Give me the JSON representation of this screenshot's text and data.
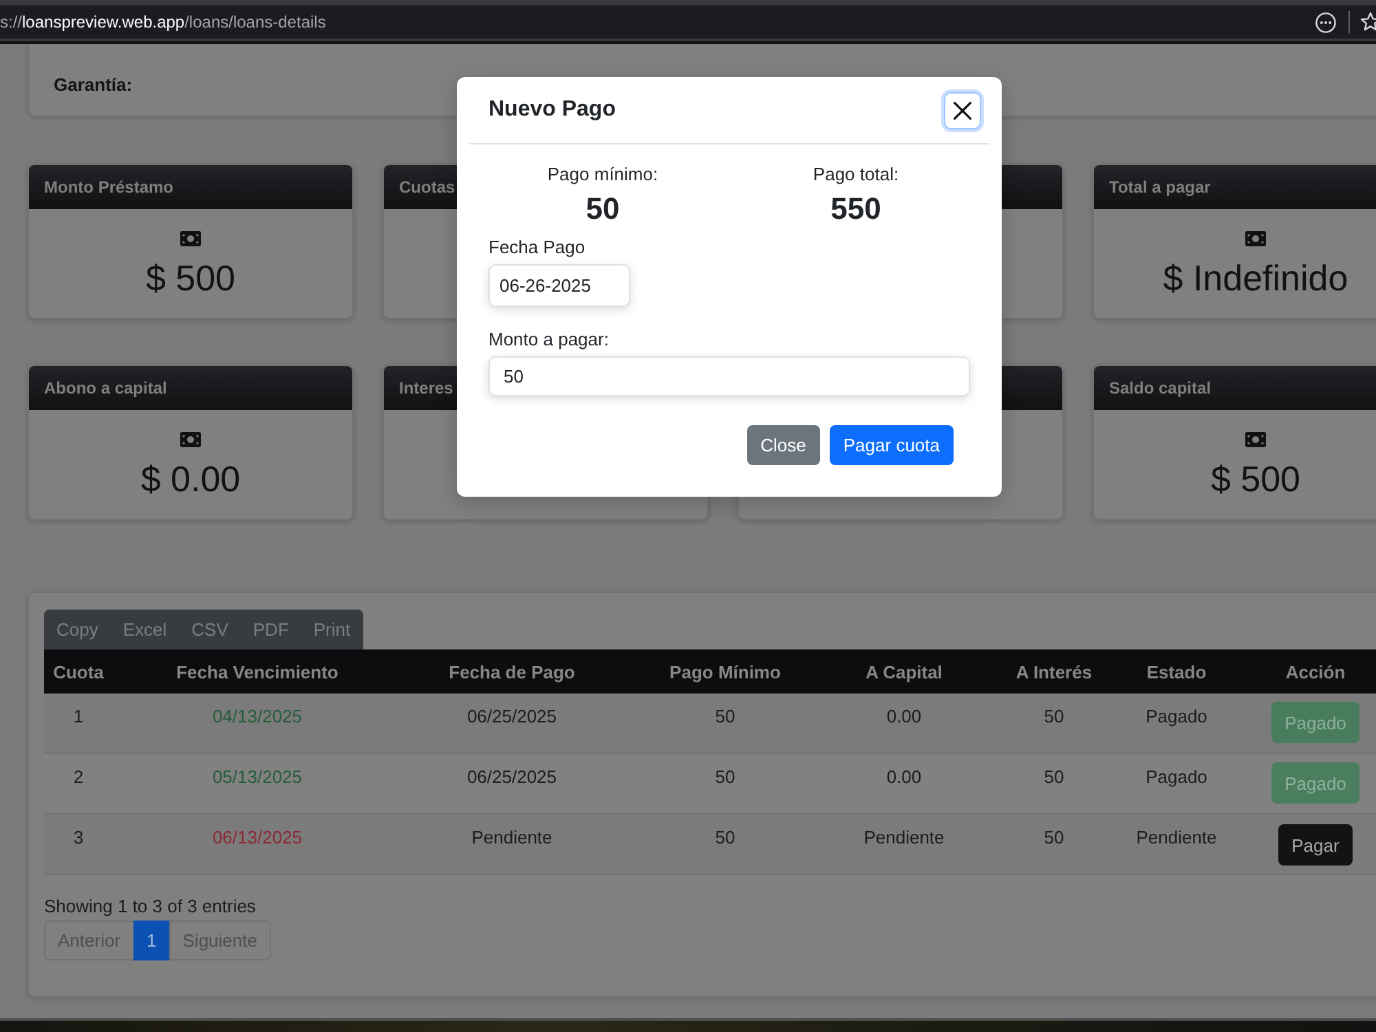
{
  "browser": {
    "address_bar": {
      "scheme": "s://",
      "host": "loanspreview.web.app",
      "path": "/loans/loans-details"
    }
  },
  "guarantee_card": {
    "label": "Garantía:"
  },
  "stat_cards": [
    {
      "title": "Monto Préstamo",
      "icon": true,
      "value": "$ 500"
    },
    {
      "title": "Cuotas",
      "icon": false
    },
    {
      "icon": false
    },
    {
      "title": "Total a pagar",
      "icon": true,
      "value": "$ Indefinido"
    },
    {
      "title": "Abono a capital",
      "icon": true,
      "value": "$ 0.00"
    },
    {
      "title": "Interes",
      "icon": false
    },
    {
      "icon": false
    },
    {
      "title": "Saldo capital",
      "icon": true,
      "value": "$ 500"
    }
  ],
  "payments": {
    "export_buttons": [
      "Copy",
      "Excel",
      "CSV",
      "PDF",
      "Print"
    ],
    "columns": [
      "Cuota",
      "Fecha Vencimiento",
      "Fecha de Pago",
      "Pago Mínimo",
      "A Capital",
      "A Interés",
      "Estado",
      "Acción"
    ],
    "rows": [
      {
        "cells": [
          "1",
          "04/13/2025",
          "06/25/2025",
          "50",
          "0.00",
          "50",
          "Pagado"
        ],
        "overdue": false,
        "action": {
          "label": "Pagado",
          "kind": "paid",
          "disabled": true
        }
      },
      {
        "cells": [
          "2",
          "05/13/2025",
          "06/25/2025",
          "50",
          "0.00",
          "50",
          "Pagado"
        ],
        "overdue": false,
        "action": {
          "label": "Pagado",
          "kind": "paid",
          "disabled": true
        }
      },
      {
        "cells": [
          "3",
          "06/13/2025",
          "Pendiente",
          "50",
          "Pendiente",
          "50",
          "Pendiente"
        ],
        "overdue": true,
        "action": {
          "label": "Pagar",
          "kind": "pay",
          "disabled": false
        }
      }
    ],
    "info": "Showing 1 to 3 of 3 entries",
    "pages": [
      {
        "label": "Anterior",
        "selected": false
      },
      {
        "label": "1",
        "selected": true
      },
      {
        "label": "Siguiente",
        "selected": false
      }
    ]
  },
  "modal": {
    "title": "Nuevo Pago",
    "close_button": {
      "focused": true
    },
    "summary": [
      {
        "label": "Pago mínimo:",
        "value": "50"
      },
      {
        "label": "Pago total:",
        "value": "550"
      }
    ],
    "fields": [
      {
        "label": "Fecha Pago",
        "value": "06-26-2025",
        "kind": "date"
      },
      {
        "label": "Monto a pagar:",
        "value": "50",
        "kind": "amount"
      }
    ],
    "buttons": [
      {
        "label": "Close",
        "kind": "secondary"
      },
      {
        "label": "Pagar cuota",
        "kind": "primary"
      }
    ]
  }
}
